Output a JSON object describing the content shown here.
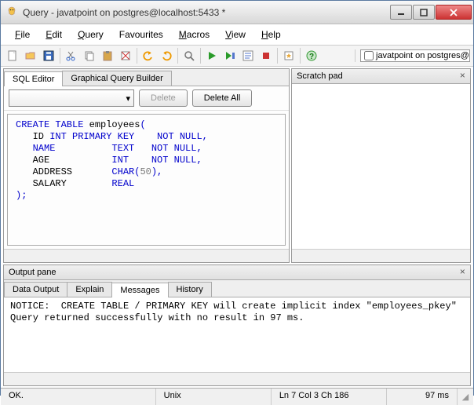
{
  "window": {
    "title": "Query - javatpoint on postgres@localhost:5433 *"
  },
  "menu": {
    "file": "File",
    "edit": "Edit",
    "query": "Query",
    "favourites": "Favourites",
    "macros": "Macros",
    "view": "View",
    "help": "Help"
  },
  "toolbar": {
    "connection_label": "javatpoint on postgres@lo"
  },
  "editor_pane": {
    "tab_sql": "SQL Editor",
    "tab_gqb": "Graphical Query Builder",
    "delete_btn": "Delete",
    "delete_all_btn": "Delete All",
    "sql_lines": [
      {
        "segs": [
          {
            "t": "CREATE TABLE",
            "c": "kw-blue"
          },
          {
            "t": " employees",
            "c": ""
          },
          {
            "t": "(",
            "c": "kw-blue"
          }
        ]
      },
      {
        "segs": [
          {
            "t": "   ID ",
            "c": ""
          },
          {
            "t": "INT PRIMARY KEY    NOT NULL,",
            "c": "kw-blue"
          }
        ]
      },
      {
        "segs": [
          {
            "t": "   ",
            "c": ""
          },
          {
            "t": "NAME          TEXT   NOT NULL,",
            "c": "kw-blue"
          }
        ]
      },
      {
        "segs": [
          {
            "t": "   AGE           ",
            "c": ""
          },
          {
            "t": "INT    NOT NULL,",
            "c": "kw-blue"
          }
        ]
      },
      {
        "segs": [
          {
            "t": "   ADDRESS       ",
            "c": ""
          },
          {
            "t": "CHAR(",
            "c": "kw-blue"
          },
          {
            "t": "50",
            "c": "kw-num"
          },
          {
            "t": "),",
            "c": "kw-blue"
          }
        ]
      },
      {
        "segs": [
          {
            "t": "   SALARY        ",
            "c": ""
          },
          {
            "t": "REAL",
            "c": "kw-blue"
          }
        ]
      },
      {
        "segs": [
          {
            "t": ");",
            "c": "kw-blue"
          }
        ]
      }
    ]
  },
  "scratch_pane": {
    "title": "Scratch pad"
  },
  "output_pane": {
    "title": "Output pane",
    "tab_data": "Data Output",
    "tab_explain": "Explain",
    "tab_messages": "Messages",
    "tab_history": "History",
    "body": "NOTICE:  CREATE TABLE / PRIMARY KEY will create implicit index \"employees_pkey\"\nQuery returned successfully with no result in 97 ms."
  },
  "status": {
    "ok": "OK.",
    "encoding": "Unix",
    "cursor": "Ln 7 Col 3 Ch 186",
    "time": "97 ms"
  }
}
